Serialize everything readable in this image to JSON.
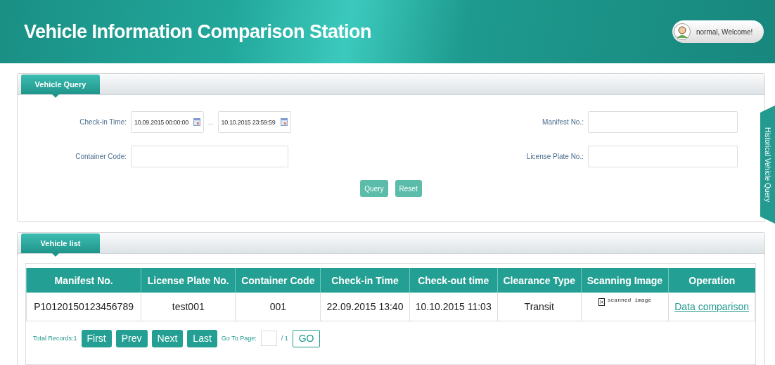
{
  "header": {
    "title": "Vehicle Information Comparison Station",
    "greeting": "normal, Welcome!"
  },
  "query_panel": {
    "tab_label": "Vehicle Query",
    "left_fields": [
      {
        "kind": "date_range",
        "label": "Check-in Time:",
        "from": "10.09.2015 00:00:00",
        "separator": "...",
        "to": "10.10.2015 23:59:59"
      },
      {
        "kind": "text",
        "label": "Container Code:"
      }
    ],
    "right_fields": [
      {
        "kind": "text",
        "label": "Manifest No.:"
      },
      {
        "kind": "text",
        "label": "License Plate No.:"
      }
    ],
    "buttons": [
      "Query",
      "Reset"
    ]
  },
  "side_tab": {
    "label": "Historical Vehicle Query"
  },
  "list_panel": {
    "tab_label": "Vehicle list",
    "columns": [
      {
        "label": "Manifest No.",
        "kind": "text"
      },
      {
        "label": "License Plate No.",
        "kind": "text"
      },
      {
        "label": "Container Code",
        "kind": "text"
      },
      {
        "label": "Check-in Time",
        "kind": "text"
      },
      {
        "label": "Check-out time",
        "kind": "text"
      },
      {
        "label": "Clearance Type",
        "kind": "text"
      },
      {
        "label": "Scanning Image",
        "kind": "image"
      },
      {
        "label": "Operation",
        "kind": "link"
      }
    ],
    "rows": [
      {
        "cells": [
          "P10120150123456789",
          "test001",
          "001",
          "22.09.2015 13:40",
          "10.10.2015 11:03",
          "Transit",
          "scanned image",
          "Data comparison"
        ]
      }
    ],
    "pagination": {
      "total": "Total Records:1",
      "buttons": [
        "First",
        "Prev",
        "Next",
        "Last"
      ],
      "goto_label": "Go To Page:",
      "page_count": "/ 1",
      "go": "GO"
    }
  }
}
